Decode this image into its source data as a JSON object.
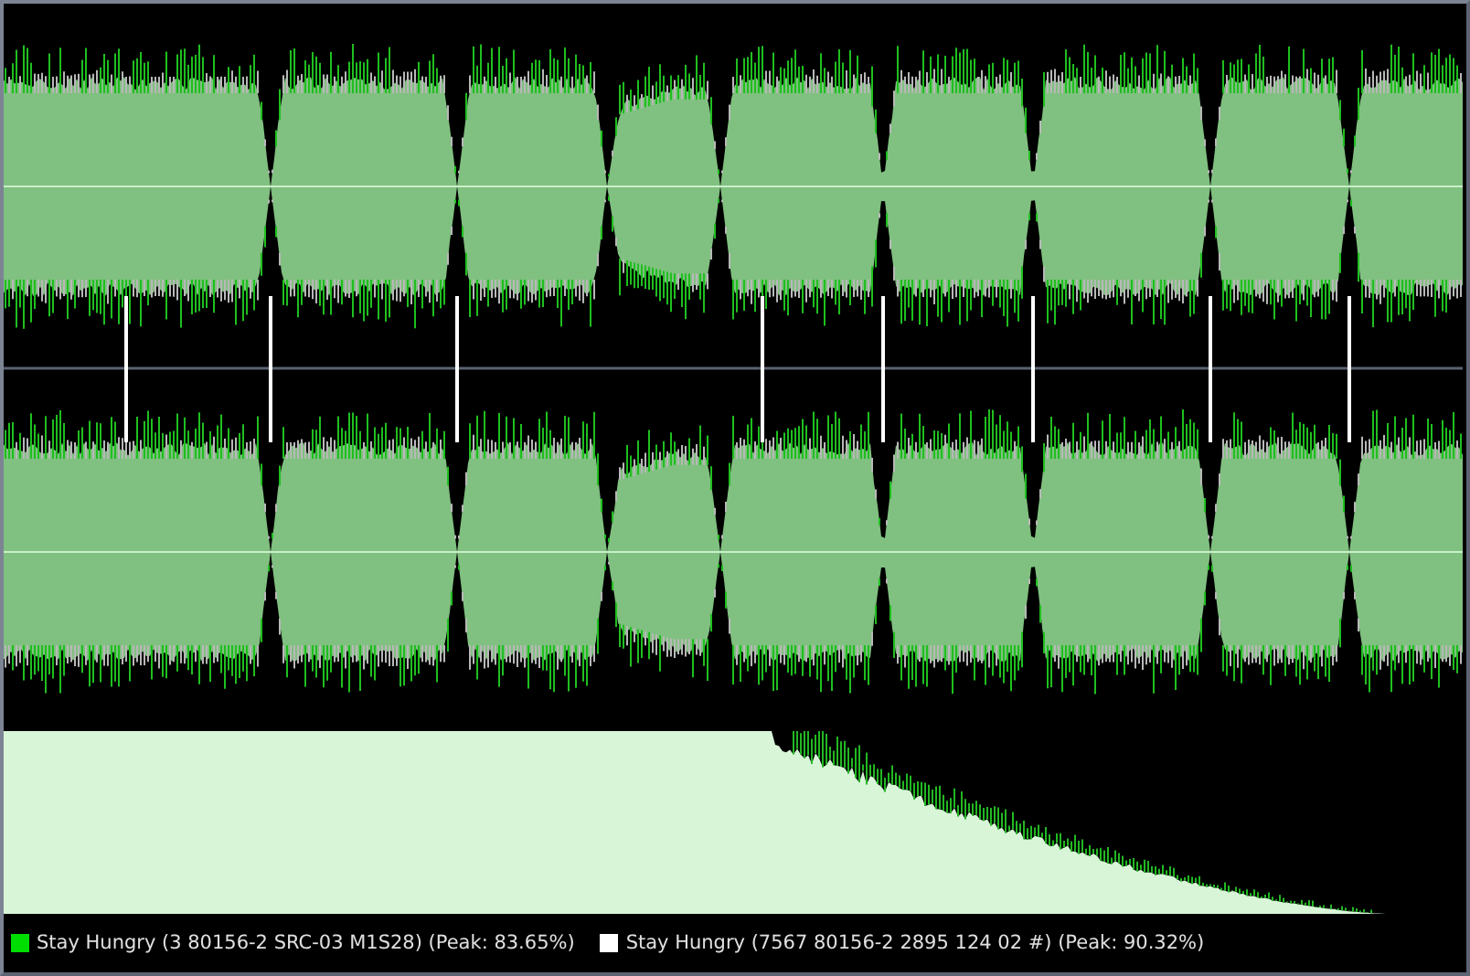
{
  "legend": [
    {
      "label": "Stay Hungry (3 80156-2 SRC-03 M1S28) (Peak: 83.65%)",
      "color": "#00dd00"
    },
    {
      "label": "Stay Hungry (7567 80156-2 2895 124 02 #) (Peak: 90.32%)",
      "color": "#ffffff"
    }
  ]
}
